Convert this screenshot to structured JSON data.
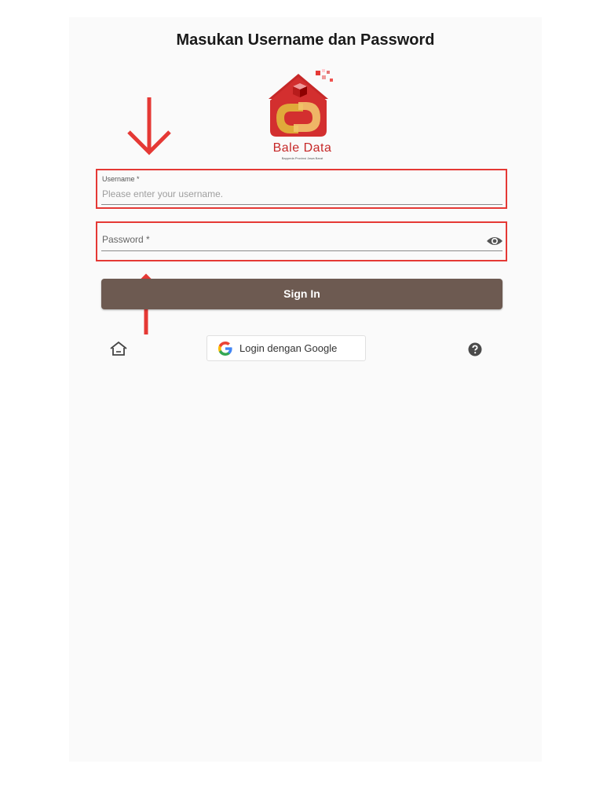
{
  "header": {
    "title": "Masukan Username dan Password"
  },
  "logo": {
    "name": "Bale Data",
    "tagline": "Bappeda Provinsi Jawa Barat"
  },
  "form": {
    "username": {
      "label": "Username *",
      "placeholder": "Please enter your username.",
      "value": ""
    },
    "password": {
      "label": "Password *",
      "value": "",
      "toggle_icon": "eye-icon"
    },
    "submit_label": "Sign In"
  },
  "footer": {
    "home_icon": "home-icon",
    "google_label": "Login dengan Google",
    "help_icon": "help-icon"
  },
  "colors": {
    "primary_button": "#6d5a51",
    "annotation_red": "#e53935",
    "brand_red": "#c62828",
    "brand_gold": "#e0a93a"
  }
}
